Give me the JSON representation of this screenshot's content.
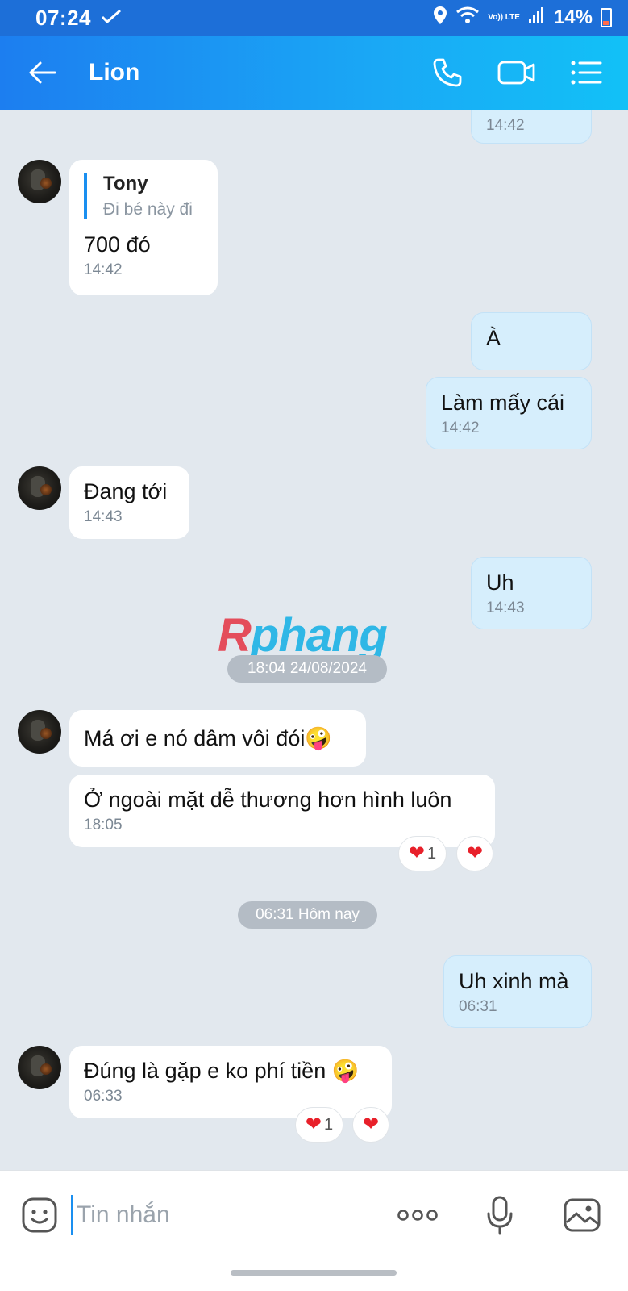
{
  "status_bar": {
    "time": "07:24",
    "volte": "Vo)) LTE",
    "battery": "14%"
  },
  "header": {
    "title": "Lion"
  },
  "messages": [
    {
      "dir": "out",
      "text": "",
      "time": "14:42"
    },
    {
      "dir": "in",
      "quote_name": "Tony",
      "quote_text": "Đi bé này đi",
      "text": "700 đó",
      "time": "14:42"
    },
    {
      "dir": "out",
      "text": "À",
      "time": ""
    },
    {
      "dir": "out",
      "text": "Làm mấy cái",
      "time": "14:42"
    },
    {
      "dir": "in",
      "text": "Đang tới",
      "time": "14:43"
    },
    {
      "dir": "out",
      "text": "Uh",
      "time": "14:43"
    },
    {
      "dir": "in",
      "text": "Má ơi e nó dâm vôi đói🤪",
      "time": ""
    },
    {
      "dir": "in",
      "text": "Ở ngoài mặt  dễ thương hơn hình luôn",
      "time": "18:05",
      "reaction_count": "1"
    },
    {
      "dir": "out",
      "text": "Uh xinh mà",
      "time": "06:31"
    },
    {
      "dir": "in",
      "text": "Đúng là gặp e ko phí tiền 🤪",
      "time": "06:33",
      "reaction_count": "1"
    }
  ],
  "dividers": {
    "first": "18:04 24/08/2024",
    "second": "06:31 Hôm nay"
  },
  "watermark": {
    "first_letter": "R",
    "rest": "phang"
  },
  "composer": {
    "placeholder": "Tin nhắn"
  },
  "colors": {
    "header_start": "#1c7ef0",
    "header_end": "#12c1f7",
    "chat_bg": "#e2e8ee",
    "out_bubble": "#d6eefc",
    "in_bubble": "#ffffff",
    "heart": "#e8202a"
  },
  "icons": [
    "back-arrow-icon",
    "phone-icon",
    "video-call-icon",
    "list-menu-icon",
    "sticker-icon",
    "more-icon",
    "microphone-icon",
    "image-icon",
    "heart-icon"
  ]
}
